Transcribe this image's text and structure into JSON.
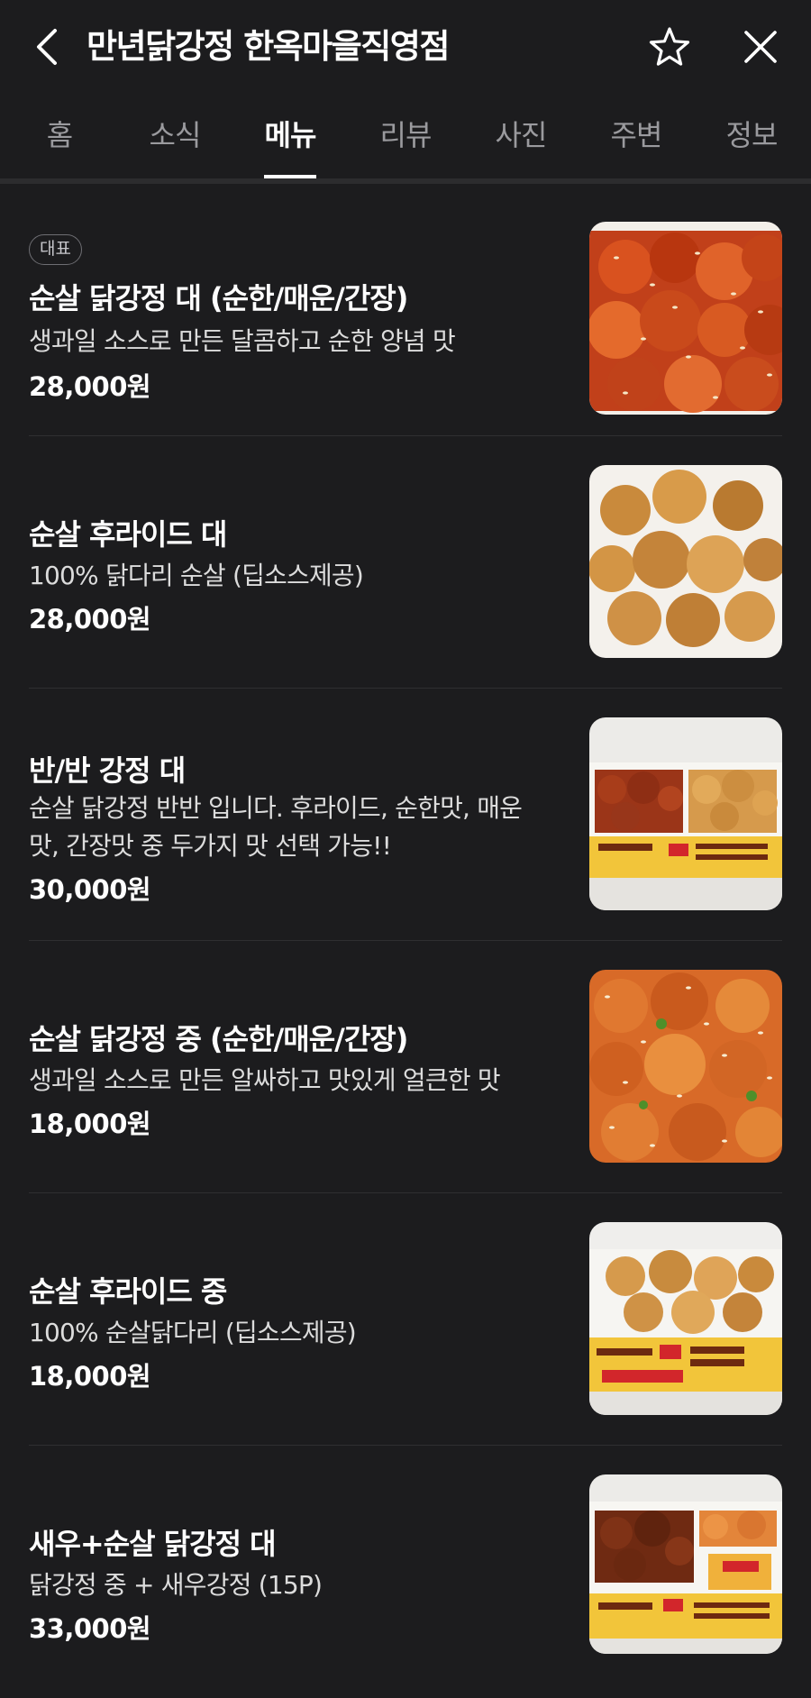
{
  "header": {
    "title": "만년닭강정 한옥마을직영점",
    "back_icon": "chevron-left-icon",
    "favorite_icon": "star-outline-icon",
    "close_icon": "close-icon"
  },
  "tabs": [
    {
      "label": "홈",
      "active": false
    },
    {
      "label": "소식",
      "active": false
    },
    {
      "label": "메뉴",
      "active": true
    },
    {
      "label": "리뷰",
      "active": false
    },
    {
      "label": "사진",
      "active": false
    },
    {
      "label": "주변",
      "active": false
    },
    {
      "label": "정보",
      "active": false
    }
  ],
  "menu": [
    {
      "badge": "대표",
      "name": "순살 닭강정 대 (순한/매운/간장)",
      "desc": "생과일 소스로 만든 달콤하고 순한 양념 맛",
      "price": "28,000원"
    },
    {
      "name": "순살 후라이드 대",
      "desc": "100% 닭다리 순살 (딥소스제공)",
      "price": "28,000원"
    },
    {
      "name": "반/반 강정 대",
      "desc": "순살 닭강정 반반 입니다. 후라이드, 순한맛, 매운맛, 간장맛 중 두가지 맛 선택 가능!!",
      "price": "30,000원"
    },
    {
      "name": "순살 닭강정 중 (순한/매운/간장)",
      "desc": "생과일 소스로 만든 알싸하고 맛있게 얼큰한 맛",
      "price": "18,000원"
    },
    {
      "name": "순살 후라이드 중",
      "desc": "100% 순살닭다리 (딥소스제공)",
      "price": "18,000원"
    },
    {
      "name": "새우+순살 닭강정 대",
      "desc": "닭강정 중 + 새우강정 (15P)",
      "price": "33,000원"
    }
  ],
  "colors": {
    "background": "#1c1c1e",
    "text_primary": "#ffffff",
    "text_secondary": "#dcdcdc",
    "tab_inactive": "#9a9a9e"
  }
}
